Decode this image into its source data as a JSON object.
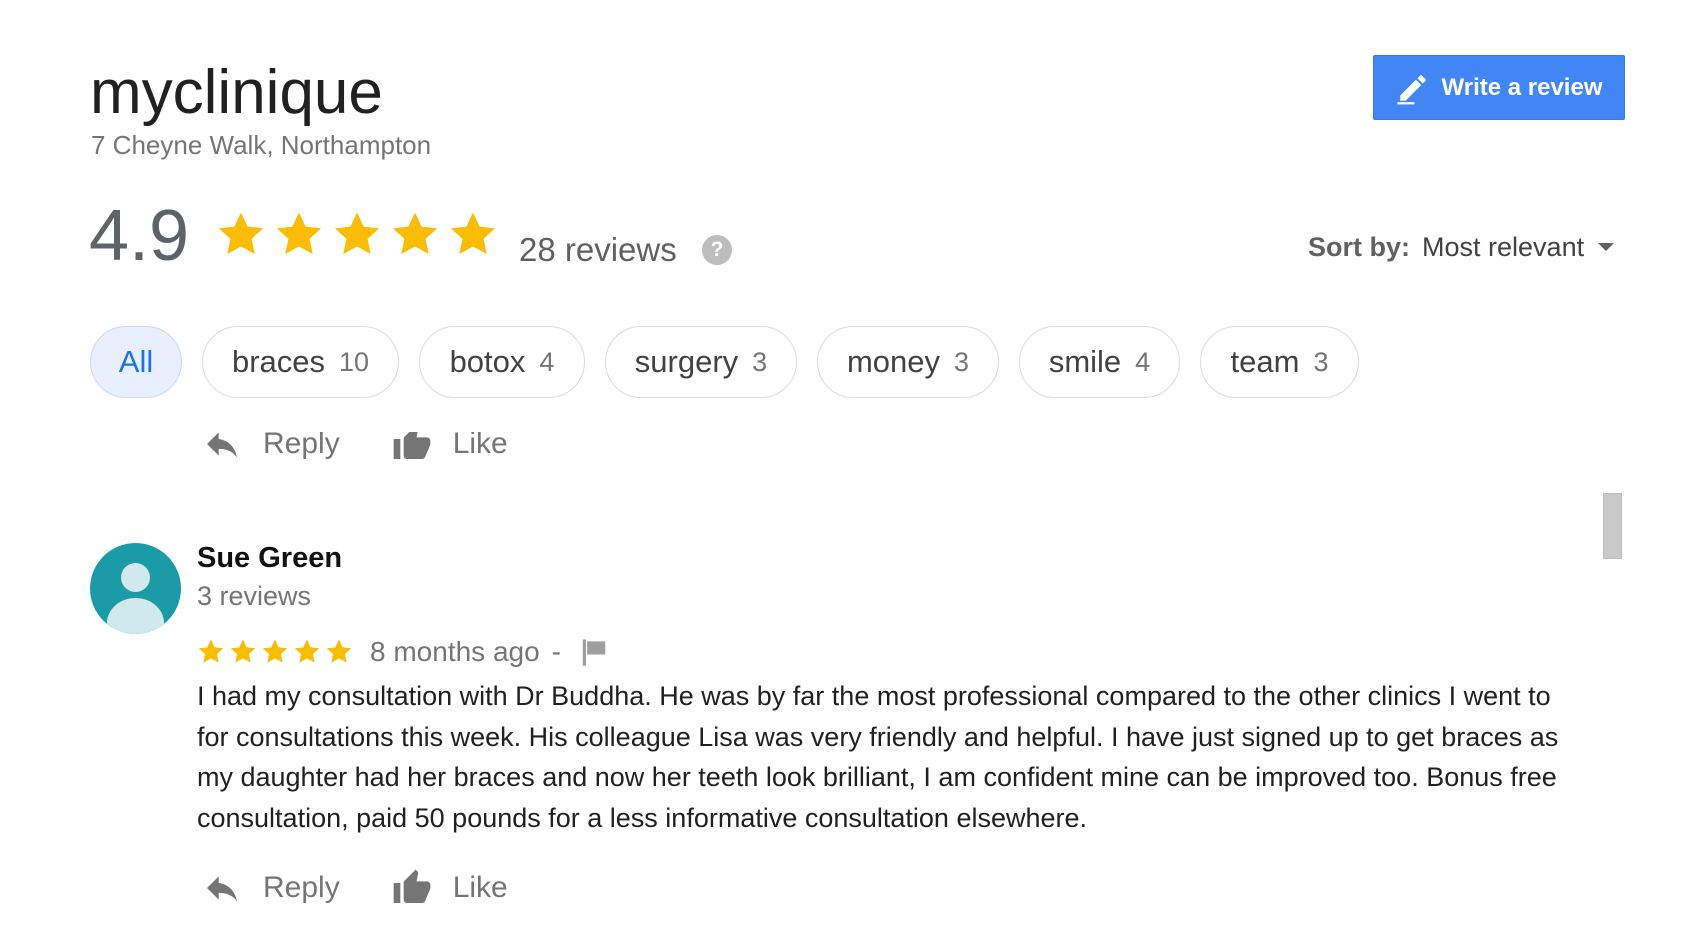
{
  "business": {
    "name": "myclinique",
    "address": "7 Cheyne Walk, Northampton"
  },
  "write_review": {
    "label": "Write a review",
    "icon": "pencil-icon"
  },
  "summary": {
    "rating": "4.9",
    "stars": 5,
    "reviews_label": "28 reviews",
    "help_icon": "?"
  },
  "sort": {
    "label": "Sort by:",
    "value": "Most relevant"
  },
  "filters": [
    {
      "label": "All",
      "count": "",
      "active": true
    },
    {
      "label": "braces",
      "count": "10",
      "active": false
    },
    {
      "label": "botox",
      "count": "4",
      "active": false
    },
    {
      "label": "surgery",
      "count": "3",
      "active": false
    },
    {
      "label": "money",
      "count": "3",
      "active": false
    },
    {
      "label": "smile",
      "count": "4",
      "active": false
    },
    {
      "label": "team",
      "count": "3",
      "active": false
    }
  ],
  "actions": {
    "reply": "Reply",
    "like": "Like"
  },
  "review": {
    "author": "Sue Green",
    "author_reviews": "3 reviews",
    "stars": 5,
    "time": "8 months ago",
    "separator": "-",
    "text": "I had my consultation with Dr Buddha. He was by far the most professional compared to the other clinics I went to for consultations this week. His colleague Lisa was very friendly and helpful. I have just signed up to get braces as my daughter had her braces and now her teeth look brilliant, I am confident mine can be improved too. Bonus free consultation, paid 50 pounds for a less informative consultation elsewhere."
  },
  "colors": {
    "star": "#fbbc04",
    "accent": "#4285f4",
    "avatar": "#1a9ba5",
    "chip_active_bg": "#e8f0fe"
  }
}
